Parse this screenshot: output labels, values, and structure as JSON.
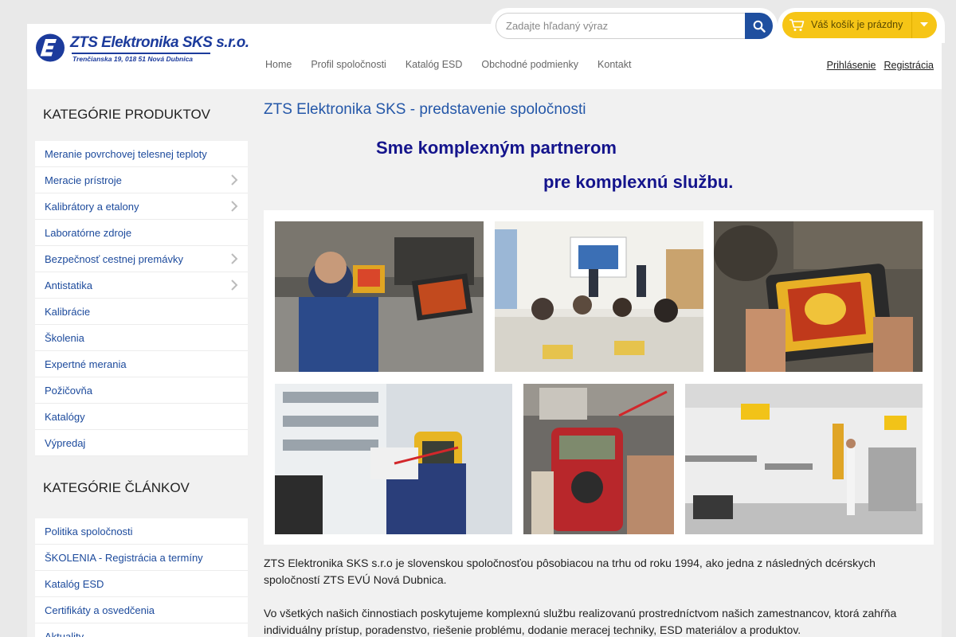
{
  "logo": {
    "title": "ZTS Elektronika SKS s.r.o.",
    "address": "Trenčianska 19, 018 51  Nová Dubnica"
  },
  "search": {
    "placeholder": "Zadajte hľadaný výraz",
    "value": ""
  },
  "cart": {
    "label": "Váš košík je prázdny"
  },
  "nav": {
    "items": [
      "Home",
      "Profil spoločnosti",
      "Katalóg ESD",
      "Obchodné podmienky",
      "Kontakt"
    ]
  },
  "auth": {
    "login": "Prihlásenie",
    "register": "Registrácia"
  },
  "sidebar": {
    "products_heading": "KATEGÓRIE PRODUKTOV",
    "products": [
      {
        "label": "Meranie povrchovej telesnej teploty"
      },
      {
        "label": "Meracie prístroje"
      },
      {
        "label": "Kalibrátory a etalony"
      },
      {
        "label": "Laboratórne zdroje"
      },
      {
        "label": "Bezpečnosť cestnej premávky"
      },
      {
        "label": "Antistatika"
      },
      {
        "label": "Kalibrácie"
      },
      {
        "label": "Školenia"
      },
      {
        "label": "Expertné merania"
      },
      {
        "label": "Požičovňa"
      },
      {
        "label": "Katalógy"
      },
      {
        "label": "Výpredaj"
      }
    ],
    "articles_heading": "KATEGÓRIE ČLÁNKOV",
    "articles": [
      {
        "label": "Politika spoločnosti"
      },
      {
        "label": "ŠKOLENIA - Registrácia a termíny"
      },
      {
        "label": "Katalóg ESD"
      },
      {
        "label": "Certifikáty a osvedčenia"
      },
      {
        "label": "Aktuality"
      }
    ]
  },
  "content": {
    "title": "ZTS Elektronika SKS - predstavenie spoločnosti",
    "tagline1": "Sme komplexným partnerom",
    "tagline2": "pre komplexnú službu.",
    "paragraph1": "ZTS Elektronika SKS s.r.o je slovenskou spoločnosťou pôsobiacou na trhu od roku 1994, ako jedna z následných dcérskych spoločností ZTS EVÚ Nová Dubnica.",
    "paragraph2": "Vo všetkých našich činnostiach poskytujeme komplexnú službu realizovanú prostredníctvom našich zamestnancov, ktorá zahŕňa individuálny prístup, poradenstvo, riešenie problému, dodanie meracej techniky, ESD materiálov a produktov."
  },
  "colors": {
    "brand": "#1c3b9c",
    "link": "#1c4a9c",
    "cart": "#f6c516",
    "search_button": "#1f4f9f",
    "tagline": "#14148c"
  }
}
